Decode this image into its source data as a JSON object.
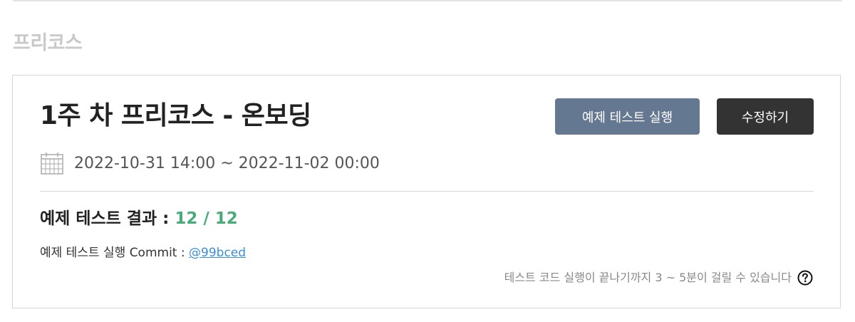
{
  "section": {
    "title": "프리코스"
  },
  "card": {
    "title": "1주 차 프리코스 - 온보딩",
    "run_button_label": "예제 테스트 실행",
    "edit_button_label": "수정하기",
    "date_icon": "calendar-icon",
    "date_range": "2022-10-31 14:00 ~ 2022-11-02 00:00",
    "result_label": "예제 테스트 결과 : ",
    "result_score": "12 / 12",
    "commit_label": "예제 테스트 실행 Commit : ",
    "commit_hash": "@99bced",
    "note_text": "테스트 코드 실행이 끝나기까지 3 ~ 5분이 걸릴 수 있습니다",
    "help_icon": "question-circle-icon"
  },
  "colors": {
    "run_button": "#657891",
    "edit_button": "#333333",
    "score": "#4aab7a",
    "link": "#3a8fd9"
  }
}
